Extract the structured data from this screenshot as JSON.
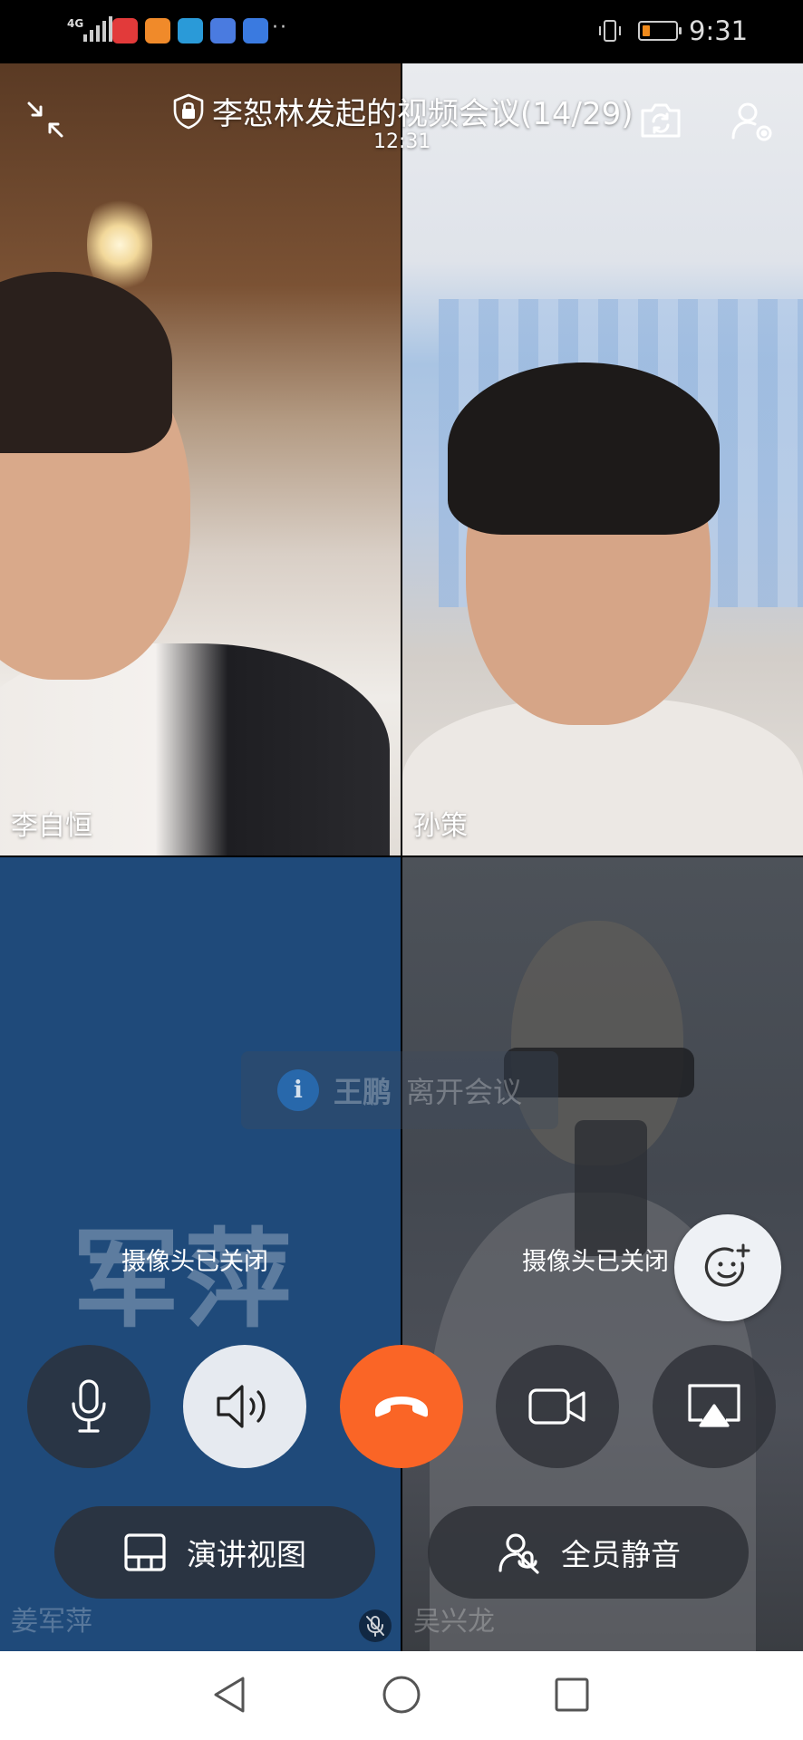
{
  "status_bar": {
    "network": "4G",
    "time": "9:31",
    "overflow": "··",
    "app_icons": [
      {
        "name": "video-app-icon",
        "color": "#e23a3a"
      },
      {
        "name": "player-app-icon",
        "color": "#f08a2a"
      },
      {
        "name": "mail-app-icon",
        "color": "#2a9ad8"
      },
      {
        "name": "music-app-icon",
        "color": "#4a7be0"
      },
      {
        "name": "baidu-app-icon",
        "color": "#3a7ae0"
      }
    ],
    "battery_color": "#f08a1b"
  },
  "meeting": {
    "title": "李恕林发起的视频会议(14/29)",
    "duration": "12:31"
  },
  "participants": [
    {
      "name": "李自恒",
      "camera_on": true
    },
    {
      "name": "孙策",
      "camera_on": true
    },
    {
      "name": "姜军萍",
      "camera_on": false,
      "avatar_text": "军萍",
      "status": "摄像头已关闭",
      "mic_muted": true
    },
    {
      "name": "吴兴龙",
      "camera_on": false,
      "status": "摄像头已关闭"
    }
  ],
  "toast": {
    "icon": "i",
    "name": "王鹏",
    "message": "离开会议"
  },
  "controls": {
    "speaker_view": "演讲视图",
    "mute_all": "全员静音"
  },
  "colors": {
    "hangup": "#fa6526",
    "tile_blue": "#1f4a7a"
  }
}
